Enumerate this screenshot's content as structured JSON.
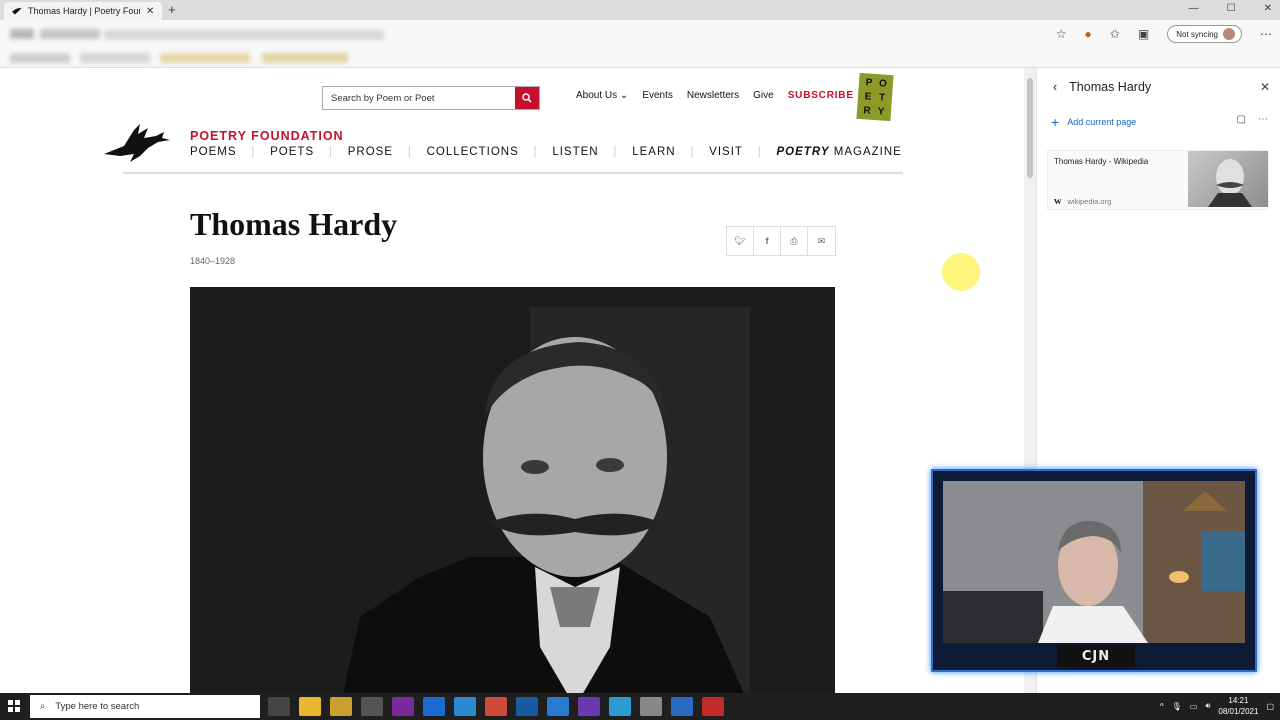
{
  "browser": {
    "tab_title": "Thomas Hardy | Poetry Foundatio",
    "new_tab": "+",
    "sync_label": "Not syncing"
  },
  "site": {
    "search_placeholder": "Search by Poem or Poet",
    "top_nav": [
      "About Us",
      "Events",
      "Newsletters",
      "Give"
    ],
    "subscribe": "SUBSCRIBE",
    "poetry_logo": [
      "P",
      "O",
      "E",
      "T",
      "R",
      "Y"
    ],
    "org_name": "POETRY FOUNDATION",
    "main_nav": [
      "POEMS",
      "POETS",
      "PROSE",
      "COLLECTIONS",
      "LISTEN",
      "LEARN",
      "VISIT"
    ],
    "magazine_bold": "POETRY",
    "magazine_rest": " MAGAZINE"
  },
  "poet": {
    "name": "Thomas Hardy",
    "dates": "1840–1928"
  },
  "side_panel": {
    "title": "Thomas Hardy",
    "add_label": "Add current page",
    "card_title": "Thomas Hardy - Wikipedia",
    "card_source_icon": "W",
    "card_source": "wikipedia.org"
  },
  "webcam": {
    "label": "CJN"
  },
  "taskbar": {
    "search_placeholder": "Type here to search",
    "time": "14:21",
    "date": "08/01/2021"
  },
  "colors": {
    "brand_red": "#c8102e",
    "link_blue": "#1a62c4"
  }
}
